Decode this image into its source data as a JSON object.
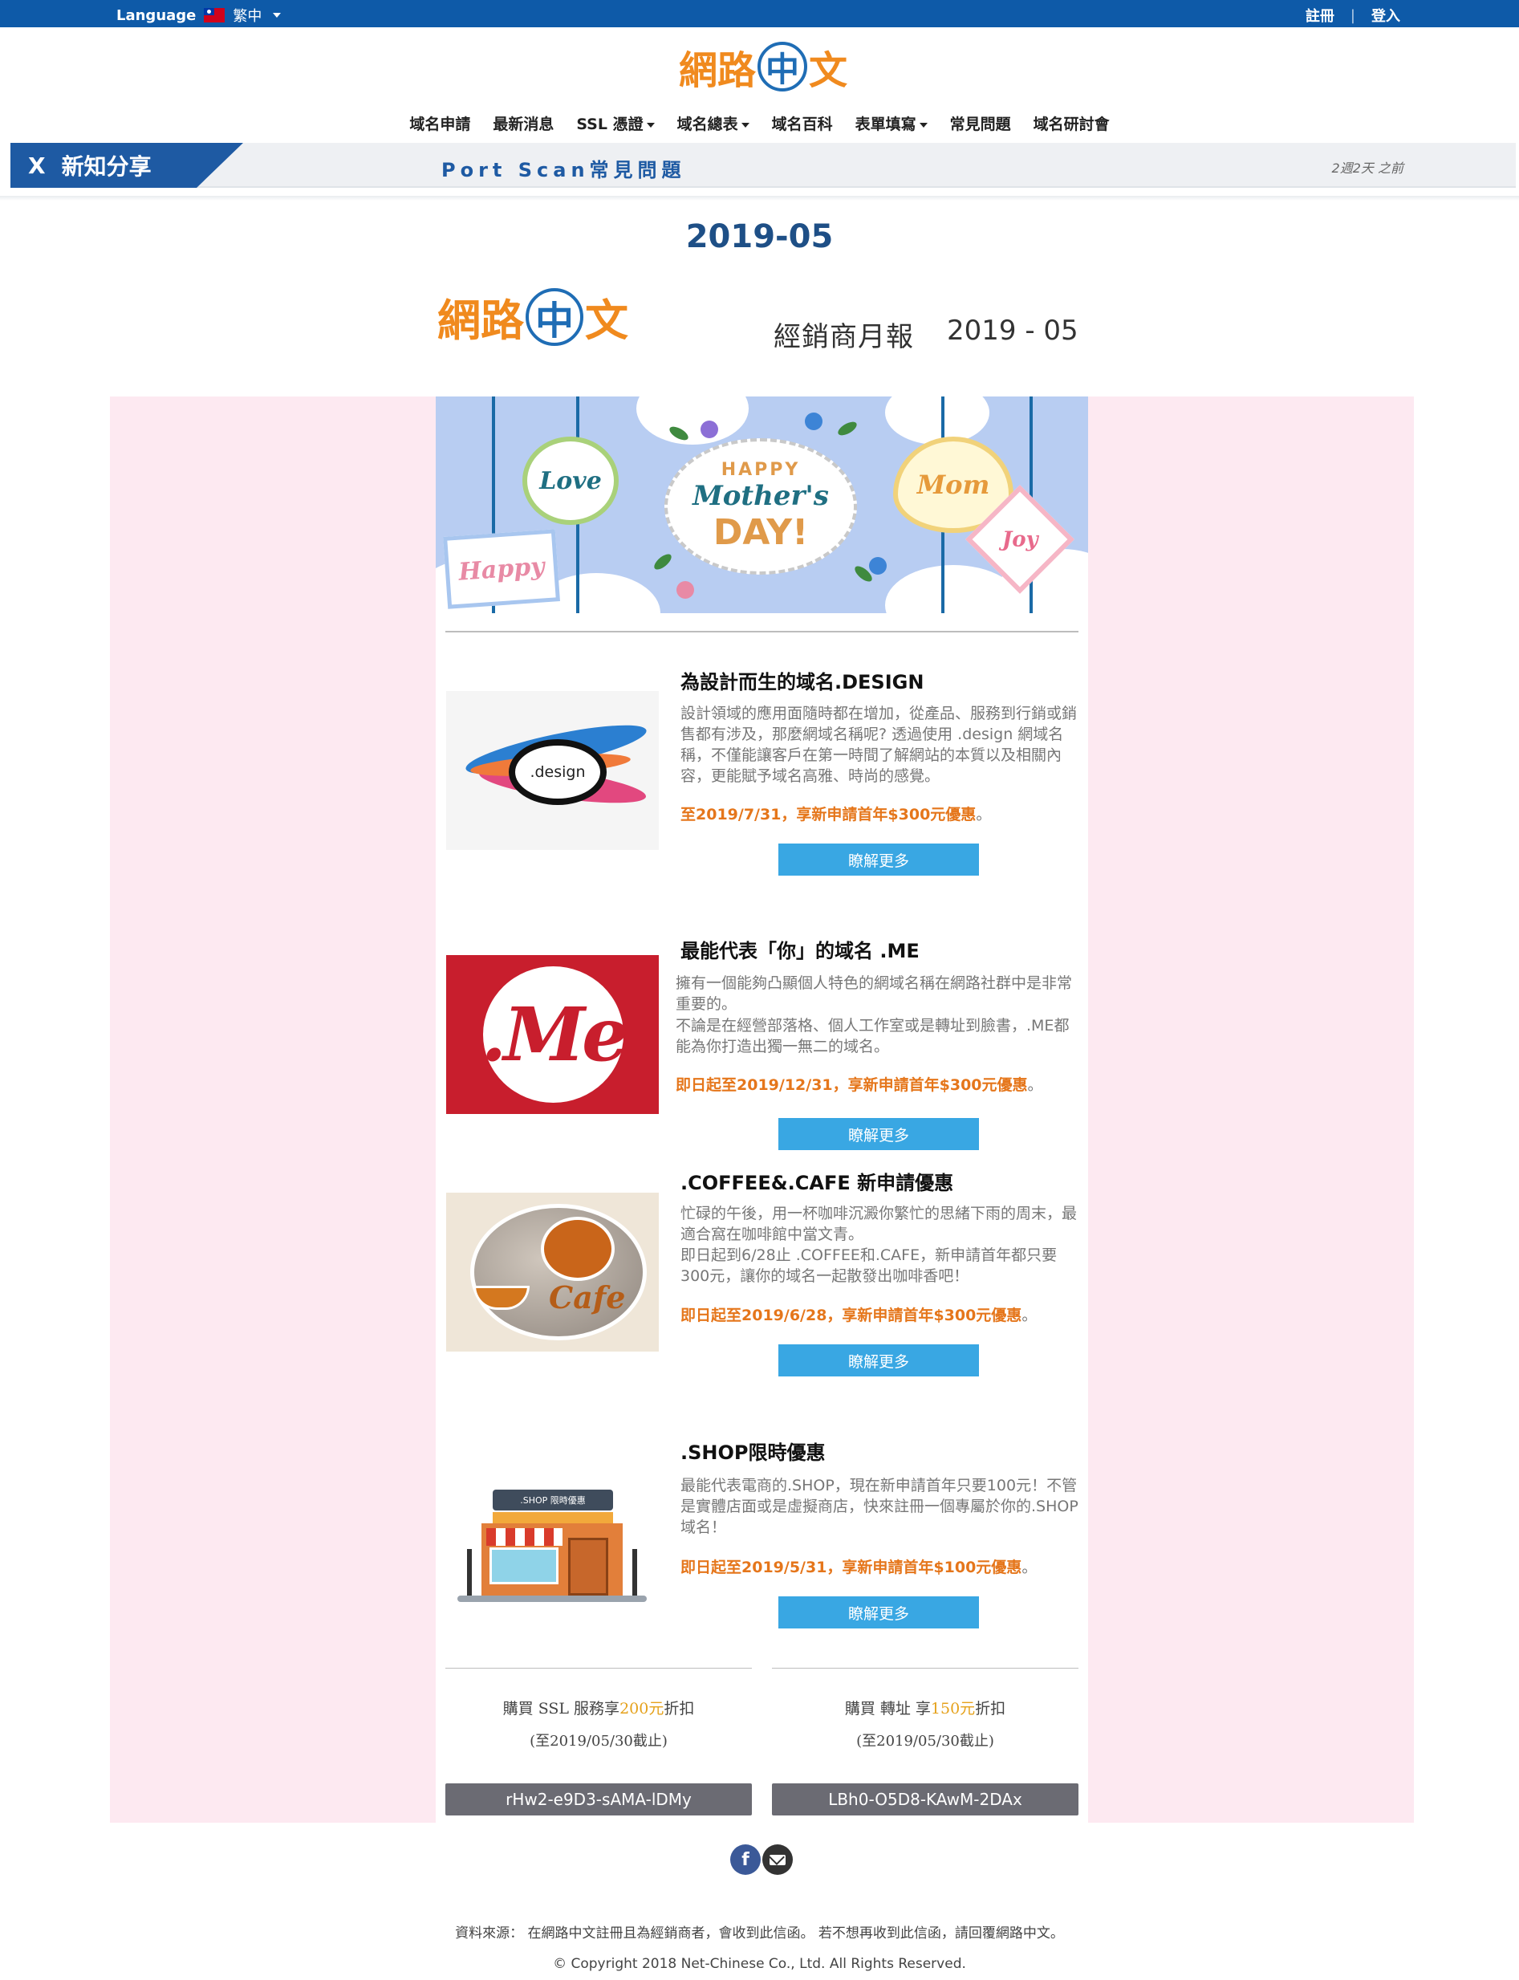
{
  "topbar": {
    "language_label": "Language",
    "language_value": "繁中",
    "register": "註冊",
    "separator": "|",
    "login": "登入"
  },
  "logo": {
    "char1": "網路",
    "char2": "中",
    "char3": "文"
  },
  "nav": {
    "items": [
      {
        "label": "域名申請",
        "dropdown": false
      },
      {
        "label": "最新消息",
        "dropdown": false
      },
      {
        "label": "SSL 憑證",
        "dropdown": true
      },
      {
        "label": "域名總表",
        "dropdown": true
      },
      {
        "label": "域名百科",
        "dropdown": false
      },
      {
        "label": "表單填寫",
        "dropdown": true
      },
      {
        "label": "常見問題",
        "dropdown": false
      },
      {
        "label": "域名研討會",
        "dropdown": false
      }
    ]
  },
  "ticker": {
    "close": "X",
    "tag": "新知分享",
    "message": "Port Scan常見問題",
    "time": "2週2天 之前"
  },
  "page": {
    "title": "2019-05",
    "newsletter_label": "經銷商月報",
    "newsletter_date": "2019 - 05"
  },
  "banner": {
    "happy": "HAPPY",
    "mothers": "Mother's",
    "day": "DAY!",
    "love": "Love",
    "mom": "Mom",
    "joy": "Joy",
    "happy_tag": "Happy"
  },
  "products": [
    {
      "title": "為設計而生的域名.DESIGN",
      "description": "設計領域的應用面隨時都在增加，從產品、服務到行銷或銷售都有涉及，那麼網域名稱呢? 透過使用 .design 網域名稱，不僅能讓客戶在第一時間了解網站的本質以及相關內容，更能賦予域名高雅、時尚的感覺。",
      "promo": "至2019/7/31，享新申請首年$300元優惠",
      "promo_end": "。",
      "button": "瞭解更多",
      "image_text": ".design"
    },
    {
      "title": "最能代表「你」的域名 .ME",
      "description": "擁有一個能夠凸顯個人特色的網域名稱在網路社群中是非常重要的。",
      "description2": "不論是在經營部落格、個人工作室或是轉址到臉書，.ME都能為你打造出獨一無二的域名。",
      "promo": "即日起至2019/12/31，享新申請首年$300元優惠",
      "promo_end": "。",
      "button": "瞭解更多",
      "image_text": ".Me"
    },
    {
      "title": ".COFFEE&.CAFE 新申請優惠",
      "description": "忙碌的午後，用一杯咖啡沉澱你繁忙的思緒下雨的周末，最適合窩在咖啡館中當文青。",
      "description2": "即日起到6/28止 .COFFEE和.CAFE，新申請首年都只要300元，讓你的域名一起散發出咖啡香吧！",
      "promo": "即日起至2019/6/28，享新申請首年$300元優惠",
      "promo_end": "。",
      "button": "瞭解更多",
      "image_text": "Cafe"
    },
    {
      "title": ".SHOP限時優惠",
      "description": "最能代表電商的.SHOP，現在新申請首年只要100元！不管是實體店面或是虛擬商店，快來註冊一個專屬於你的.SHOP域名！",
      "promo": "即日起至2019/5/31，享新申請首年$100元優惠",
      "promo_end": "。",
      "button": "瞭解更多",
      "image_text": ".SHOP 限時優惠"
    }
  ],
  "coupons": [
    {
      "prefix": "購買 SSL 服務享",
      "amount": "200元",
      "suffix": "折扣",
      "note": "(至2019/05/30截止)",
      "code": "rHw2-e9D3-sAMA-lDMy"
    },
    {
      "prefix": "購買 轉址 享",
      "amount": "150元",
      "suffix": "折扣",
      "note": "(至2019/05/30截止)",
      "code": "LBh0-O5D8-KAwM-2DAx"
    }
  ],
  "footer": {
    "facebook": "f",
    "note": "資料來源： 在網路中文註冊且為經銷商者，會收到此信函。 若不想再收到此信函，請回覆網路中文。",
    "copyright": "© Copyright 2018 Net-Chinese Co., Ltd. All Rights Reserved."
  },
  "colors": {
    "topbar": "#0e5aa8",
    "accent_blue": "#1e5aa3",
    "orange": "#e5761b",
    "button_blue": "#39a7e3",
    "pink_band": "#fde9f1",
    "code_gray": "#6b6b73"
  }
}
